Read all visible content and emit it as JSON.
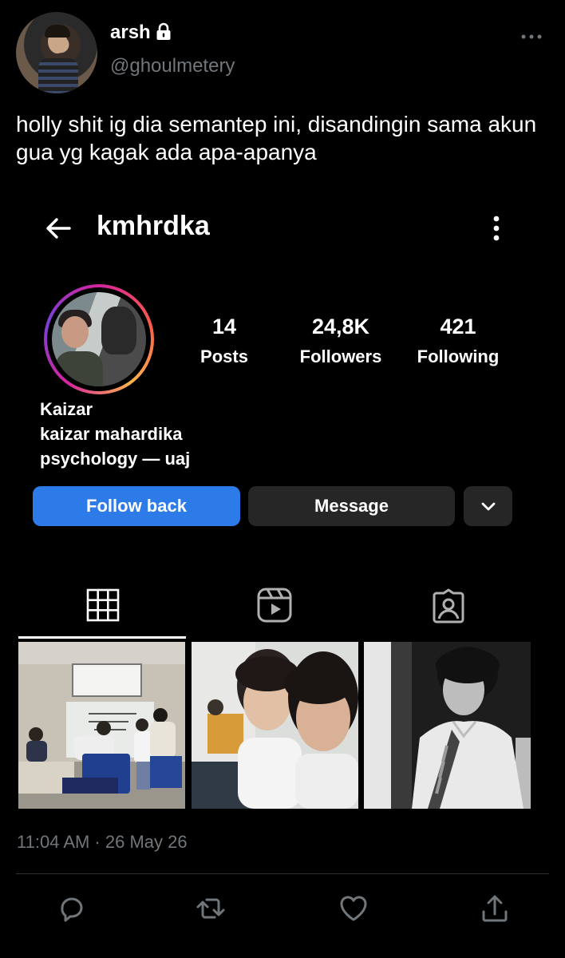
{
  "tweet": {
    "display_name": "arsh",
    "handle": "@ghoulmetery",
    "text": "holly shit ig dia semantep ini, disandingin sama akun gua yg kagak ada apa-apanya",
    "timestamp": "11:04 AM · 26 May 26",
    "icons": {
      "lock": "lock-icon",
      "more": "more-horizontal-icon",
      "reply": "reply-icon",
      "retweet": "retweet-icon",
      "like": "heart-icon",
      "share": "share-icon"
    }
  },
  "instagram": {
    "username": "kmhrdka",
    "stats": {
      "posts": {
        "value": "14",
        "label": "Posts"
      },
      "followers": {
        "value": "24,8K",
        "label": "Followers"
      },
      "following": {
        "value": "421",
        "label": "Following"
      }
    },
    "bio": {
      "name": "Kaizar",
      "full_name": "kaizar mahardika",
      "description": "psychology — uaj"
    },
    "buttons": {
      "follow_back": "Follow back",
      "message": "Message"
    },
    "tabs": [
      "grid-icon",
      "reels-icon",
      "tagged-icon"
    ],
    "colors": {
      "follow_button": "#2d7be8",
      "secondary_button": "#262626"
    }
  }
}
